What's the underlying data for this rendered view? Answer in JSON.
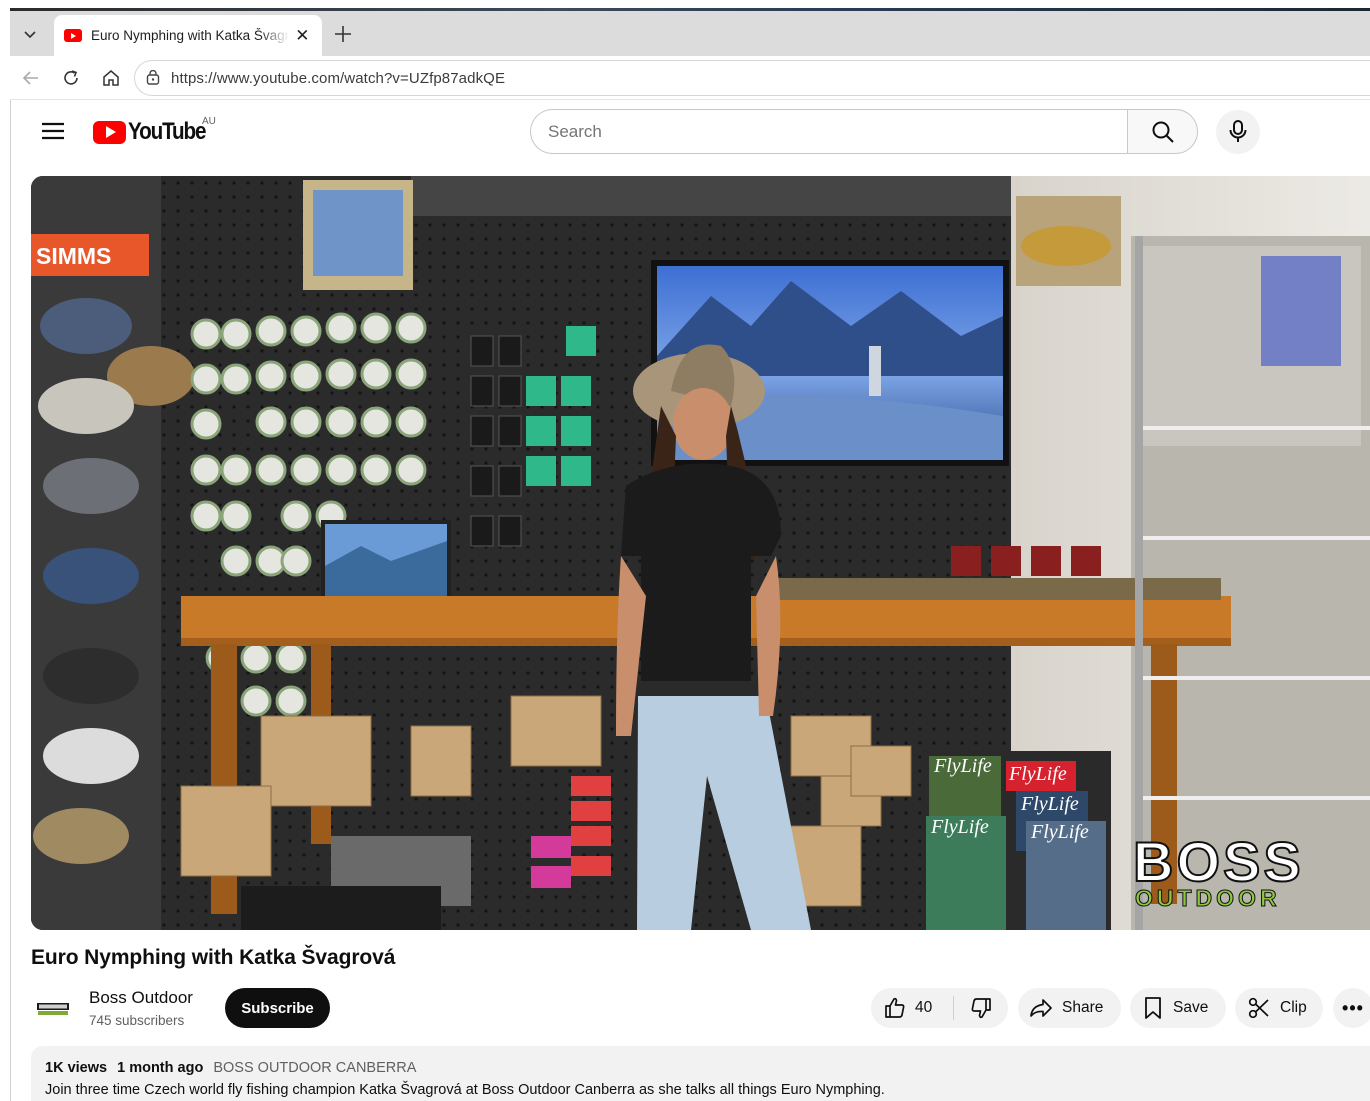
{
  "browser": {
    "tab_title": "Euro Nymphing with Katka Švagrová - YouTube",
    "url": "https://www.youtube.com/watch?v=UZfp87adkQE"
  },
  "youtube": {
    "logo_text": "YouTube",
    "country_code": "AU",
    "search_placeholder": "Search"
  },
  "video": {
    "overlay": {
      "store_sign": "SIMMS",
      "watermark_top": "BOSS",
      "watermark_bottom": "OUTDOOR",
      "magazine_title": "FlyLife"
    },
    "title": "Euro Nymphing with Katka Švagrová",
    "channel_name": "Boss Outdoor",
    "subscribers": "745 subscribers",
    "subscribe_label": "Subscribe",
    "like_count": "40",
    "share_label": "Share",
    "save_label": "Save",
    "clip_label": "Clip",
    "more_label": "•••"
  },
  "description": {
    "views": "1K views",
    "age": "1 month ago",
    "tag": "BOSS OUTDOOR CANBERRA",
    "text": "Join three time Czech world fly fishing champion Katka Švagrová at Boss Outdoor Canberra as she talks all things Euro Nymphing."
  },
  "colors": {
    "youtube_red": "#ff0000",
    "subscribe_bg": "#0f0f0f",
    "pill_bg": "#f2f2f2",
    "watermark_green": "#8dc63f"
  }
}
